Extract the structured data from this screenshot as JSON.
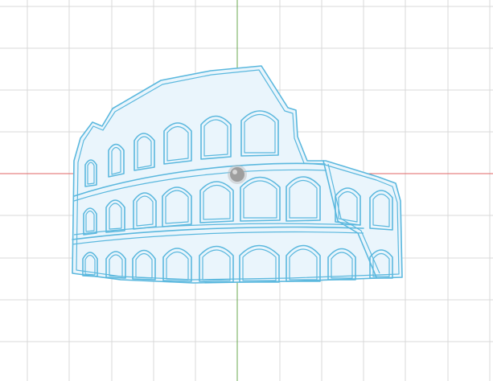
{
  "canvas": {
    "background": "#ffffff",
    "grid_color": "#d9d9d9",
    "x_axis_color": "#e06666",
    "y_axis_color": "#6aa84f"
  },
  "sketch": {
    "subject": "colosseum-outline",
    "stroke_color": "#5bb8de",
    "fill_color": "#eaf5fc"
  },
  "origin_handle": {
    "icon": "origin-dot-icon",
    "color": "#9e9e9e"
  }
}
